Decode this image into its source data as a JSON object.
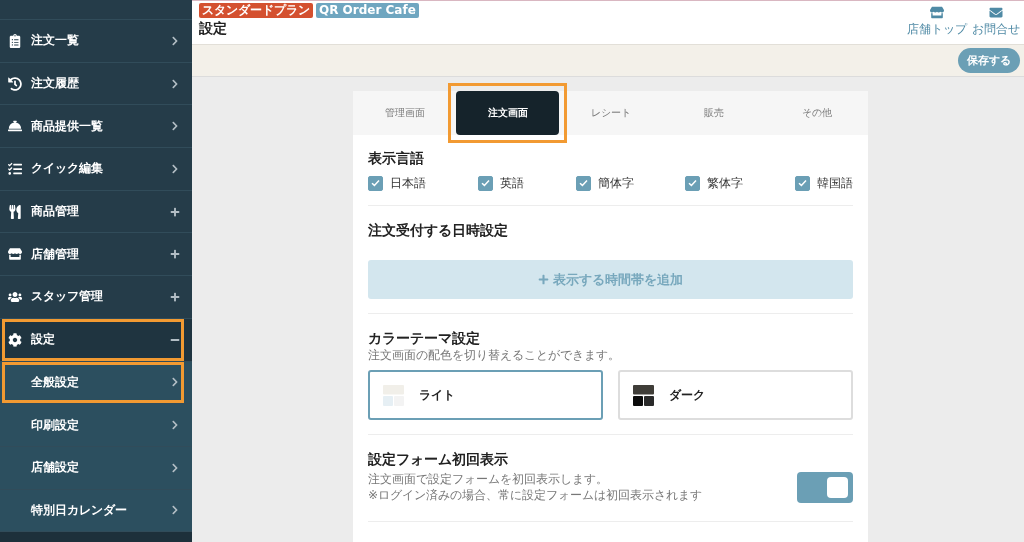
{
  "sidebar": {
    "items": [
      {
        "label": "注文一覧",
        "kind": "link",
        "highlighted": false
      },
      {
        "label": "注文履歴",
        "kind": "link",
        "highlighted": false
      },
      {
        "label": "商品提供一覧",
        "kind": "link",
        "highlighted": false
      },
      {
        "label": "クイック編集",
        "kind": "link",
        "highlighted": false
      },
      {
        "label": "商品管理",
        "kind": "group",
        "expanded": false,
        "highlighted": false
      },
      {
        "label": "店舗管理",
        "kind": "group",
        "expanded": false,
        "highlighted": false
      },
      {
        "label": "スタッフ管理",
        "kind": "group",
        "expanded": false,
        "highlighted": false
      },
      {
        "label": "設定",
        "kind": "group",
        "expanded": true,
        "highlighted": true,
        "children": [
          {
            "label": "全般設定",
            "kind": "link",
            "highlighted": true
          },
          {
            "label": "印刷設定",
            "kind": "link",
            "highlighted": false
          },
          {
            "label": "店舗設定",
            "kind": "link",
            "highlighted": false
          },
          {
            "label": "特別日カレンダー",
            "kind": "link",
            "highlighted": false
          }
        ]
      }
    ]
  },
  "header": {
    "badges": [
      {
        "text": "スタンダードプラン",
        "kind": "plan"
      },
      {
        "text": "QR Order Cafe",
        "kind": "store"
      }
    ],
    "title": "設定",
    "links": [
      {
        "label": "店舗トップ",
        "kind": "store"
      },
      {
        "label": "お問合せ",
        "kind": "contact"
      }
    ]
  },
  "toolbar": {
    "save_button": "保存する"
  },
  "settings": {
    "tabs": [
      {
        "label": "管理画面",
        "selected": false,
        "highlighted": false
      },
      {
        "label": "注文画面",
        "selected": true,
        "highlighted": true
      },
      {
        "label": "レシート",
        "selected": false,
        "highlighted": false
      },
      {
        "label": "販売",
        "selected": false,
        "highlighted": false
      },
      {
        "label": "その他",
        "selected": false,
        "highlighted": false
      }
    ],
    "sections": [
      {
        "kind": "checkboxes",
        "title": "表示言語",
        "options": [
          {
            "label": "日本語",
            "checked": true
          },
          {
            "label": "英語",
            "checked": true
          },
          {
            "label": "簡体字",
            "checked": true
          },
          {
            "label": "繁体字",
            "checked": true
          },
          {
            "label": "韓国語",
            "checked": true
          }
        ]
      },
      {
        "kind": "add_button",
        "title": "注文受付する日時設定",
        "button": "表示する時間帯を追加"
      },
      {
        "kind": "theme",
        "title": "カラーテーマ設定",
        "description": "注文画面の配色を切り替えることができます。",
        "options": [
          {
            "label": "ライト",
            "kind": "light",
            "selected": true
          },
          {
            "label": "ダーク",
            "kind": "dark",
            "selected": false
          }
        ]
      },
      {
        "kind": "toggle",
        "title": "設定フォーム初回表示",
        "notes": [
          "注文画面で設定フォームを初回表示します。",
          "※ログイン済みの場合、常に設定フォームは初回表示されます"
        ],
        "on": true
      }
    ]
  }
}
